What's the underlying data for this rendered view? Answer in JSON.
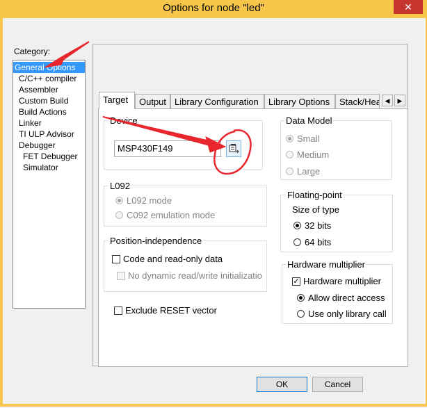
{
  "window": {
    "title": "Options for node \"led\"",
    "close_glyph": "✕"
  },
  "category": {
    "label": "Category:",
    "items": [
      {
        "label": "General Options",
        "selected": true
      },
      {
        "label": "C/C++ compiler"
      },
      {
        "label": "Assembler"
      },
      {
        "label": "Custom Build"
      },
      {
        "label": "Build Actions"
      },
      {
        "label": "Linker"
      },
      {
        "label": "TI ULP Advisor"
      },
      {
        "label": "Debugger"
      },
      {
        "label": "FET Debugger",
        "indent": true
      },
      {
        "label": "Simulator",
        "indent": true
      }
    ]
  },
  "tabs": [
    "Target",
    "Output",
    "Library Configuration",
    "Library Options",
    "Stack/Hea"
  ],
  "tab_scroll": {
    "left": "◀",
    "right": "▶"
  },
  "device": {
    "title": "Device",
    "value": "MSP430F149"
  },
  "data_model": {
    "title": "Data Model",
    "options": [
      "Small",
      "Medium",
      "Large"
    ],
    "selected": 0
  },
  "l092": {
    "title": "L092",
    "options": [
      "L092 mode",
      "C092 emulation mode"
    ],
    "selected": 0
  },
  "floating_point": {
    "title": "Floating-point",
    "size_label": "Size of type",
    "options": [
      "32 bits",
      "64 bits"
    ],
    "selected": 0
  },
  "position_independence": {
    "title": "Position-independence",
    "code_readonly": "Code and read-only data",
    "no_dynamic": "No dynamic read/write initializatio"
  },
  "hardware_multiplier": {
    "title": "Hardware multiplier",
    "checkbox_label": "Hardware multiplier",
    "checked": true,
    "options": [
      "Allow direct access",
      "Use only library call"
    ],
    "selected": 0
  },
  "exclude_reset": "Exclude RESET vector",
  "buttons": {
    "ok": "OK",
    "cancel": "Cancel"
  },
  "annotation_color": "#e8262d"
}
